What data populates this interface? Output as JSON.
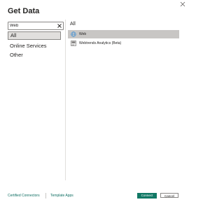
{
  "dialog": {
    "title": "Get Data",
    "close_icon": "close-icon"
  },
  "search": {
    "value": "Web",
    "placeholder": "Search",
    "clear_icon": "close-icon"
  },
  "categories": [
    {
      "label": "All",
      "selected": true
    },
    {
      "label": "Online Services",
      "selected": false
    },
    {
      "label": "Other",
      "selected": false
    }
  ],
  "results": {
    "section_label": "All",
    "items": [
      {
        "label": "Web",
        "icon": "globe-icon",
        "selected": true
      },
      {
        "label": "Webtrends Analytics (Beta)",
        "icon": "webtrends-icon",
        "selected": false
      }
    ]
  },
  "footer": {
    "certified_connectors": "Certified Connectors",
    "template_apps": "Template Apps",
    "connect_label": "Connect",
    "cancel_label": "Cancel"
  },
  "colors": {
    "accent": "#117865",
    "link": "#0e6e62",
    "selected_bg": "#c8c6c4"
  }
}
